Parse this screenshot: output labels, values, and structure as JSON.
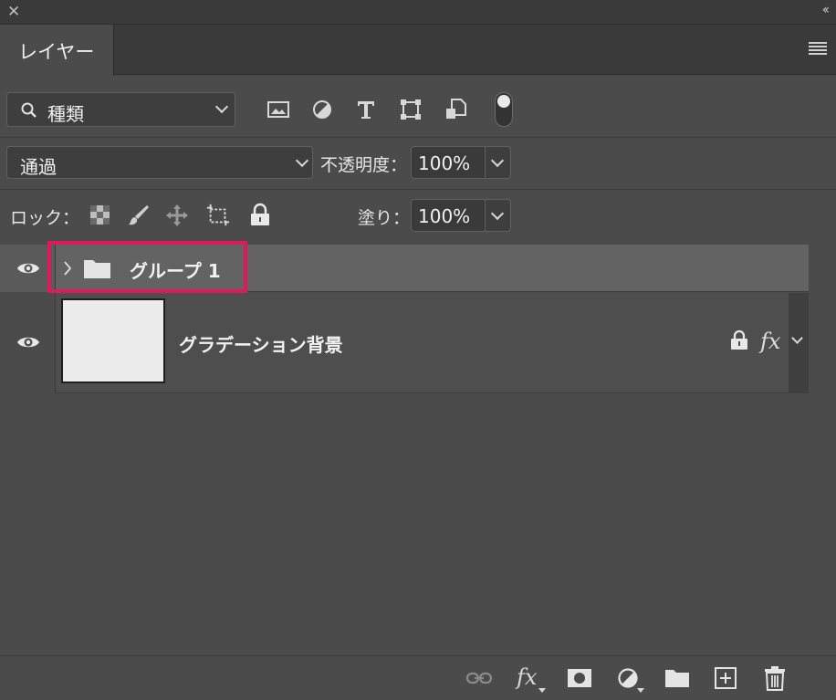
{
  "panel": {
    "tab_label": "レイヤー"
  },
  "filter": {
    "kind_label": "種類",
    "icons": [
      "image-filter-icon",
      "adjustment-filter-icon",
      "type-filter-icon",
      "shape-filter-icon",
      "smart-object-filter-icon"
    ]
  },
  "blend": {
    "mode": "通過",
    "opacity_label": "不透明度：",
    "opacity_value": "100%"
  },
  "lock": {
    "label": "ロック：",
    "fill_label": "塗り：",
    "fill_value": "100%"
  },
  "layers": [
    {
      "name": "グループ 1",
      "type": "group",
      "visible": true,
      "selected": true
    },
    {
      "name": "グラデーション背景",
      "type": "pixel",
      "visible": true,
      "locked": true,
      "has_fx": true
    }
  ],
  "layer_fx_label": "fx",
  "footer": {
    "fx_label": "fx"
  },
  "colors": {
    "panel_bg": "#4b4b4b",
    "selected_row": "#636363",
    "highlight_border": "#e0185c"
  }
}
